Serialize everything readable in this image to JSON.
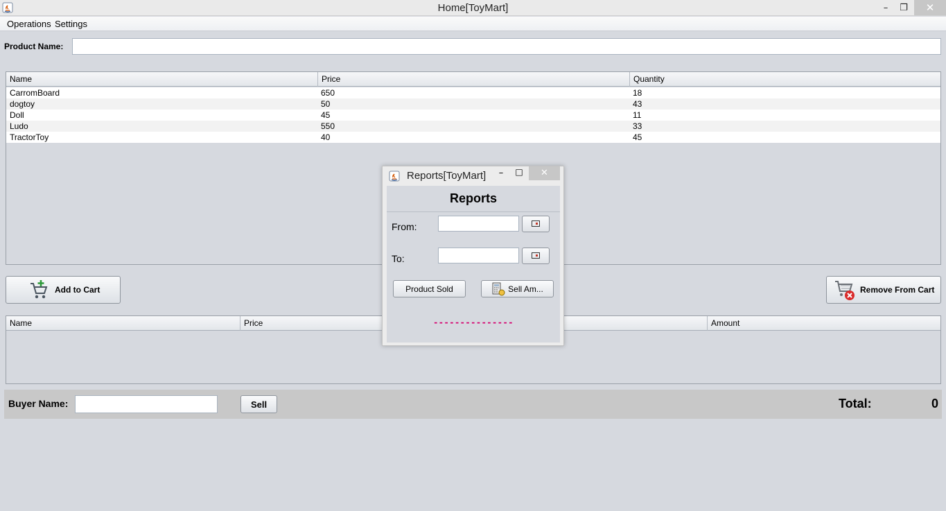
{
  "window": {
    "title": "Home[ToyMart]",
    "min_glyph": "–",
    "max_glyph": "❐",
    "close_glyph": "✕"
  },
  "menu": {
    "items": [
      "Operations",
      "Settings"
    ]
  },
  "product": {
    "label": "Product Name:",
    "value": ""
  },
  "products_table": {
    "headers": [
      "Name",
      "Price",
      "Quantity"
    ],
    "rows": [
      [
        "CarromBoard",
        "650",
        "18"
      ],
      [
        "dogtoy",
        "50",
        "43"
      ],
      [
        "Doll",
        "45",
        "11"
      ],
      [
        "Ludo",
        "550",
        "33"
      ],
      [
        "TractorToy",
        "40",
        "45"
      ]
    ]
  },
  "buttons": {
    "add_to_cart": "Add to Cart",
    "remove_from_cart": "Remove From Cart"
  },
  "cart_table": {
    "headers": [
      "Name",
      "Price",
      "Amount"
    ]
  },
  "buyer": {
    "label": "Buyer Name:",
    "value": "",
    "sell": "Sell",
    "total_label": "Total:",
    "total_value": "0"
  },
  "reports": {
    "title": "Reports[ToyMart]",
    "heading": "Reports",
    "from_label": "From:",
    "to_label": "To:",
    "product_sold": "Product Sold",
    "sell_amount": "Sell Am...",
    "result": "---------------",
    "result_color": "#d6006e"
  },
  "colors": {
    "background": "#d6d9df",
    "bottom_bar": "#c8c8c8",
    "close_button": "#c7c7c7"
  }
}
